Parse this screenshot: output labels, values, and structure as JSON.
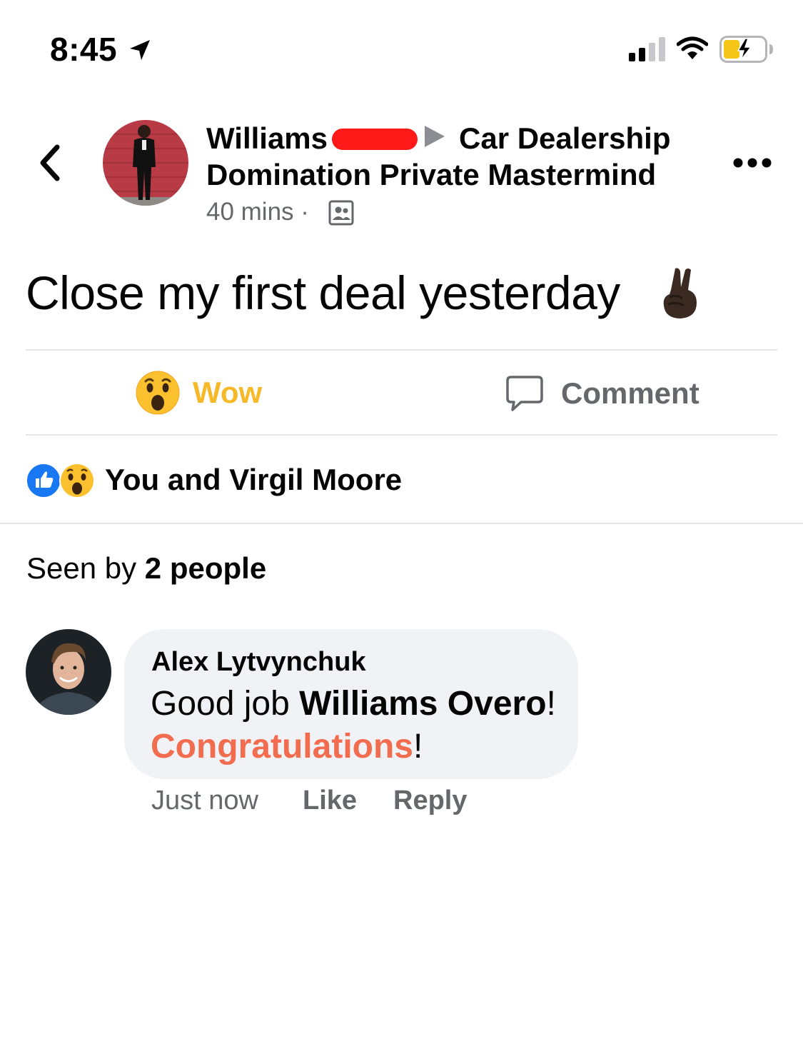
{
  "status_bar": {
    "time": "8:45",
    "icons": [
      "location-arrow-icon",
      "cellular-signal-icon",
      "wifi-icon",
      "battery-charging-icon"
    ]
  },
  "header": {
    "author_name": "Williams",
    "group_name": "Car Dealership Domination Private Mastermind",
    "time_ago": "40 mins",
    "separator": "·",
    "icons": [
      "back-chevron-icon",
      "group-privacy-icon",
      "more-options-icon"
    ]
  },
  "post": {
    "text": "Close my first deal yesterday",
    "emoji": "crossed-fingers-emoji"
  },
  "actions": {
    "reaction_label": "Wow",
    "comment_label": "Comment"
  },
  "reactions": {
    "icons": [
      "like-reaction-icon",
      "wow-reaction-icon"
    ],
    "summary": "You and Virgil Moore"
  },
  "seen": {
    "prefix": "Seen by",
    "count": "2 people"
  },
  "comments": [
    {
      "author": "Alex Lytvynchuk",
      "text_before": "Good job ",
      "mention": "Williams Overo",
      "text_after": "!",
      "highlight": "Congratulations",
      "text_end": "!",
      "time": "Just now",
      "like_label": "Like",
      "reply_label": "Reply"
    }
  ],
  "colors": {
    "wow": "#f7b928",
    "secondary_text": "#65676b",
    "divider": "#e4e6eb",
    "bubble": "#f0f2f5",
    "highlight": "#f26c4f",
    "like_blue": "#1877f2",
    "redaction": "#ff1a1a"
  }
}
